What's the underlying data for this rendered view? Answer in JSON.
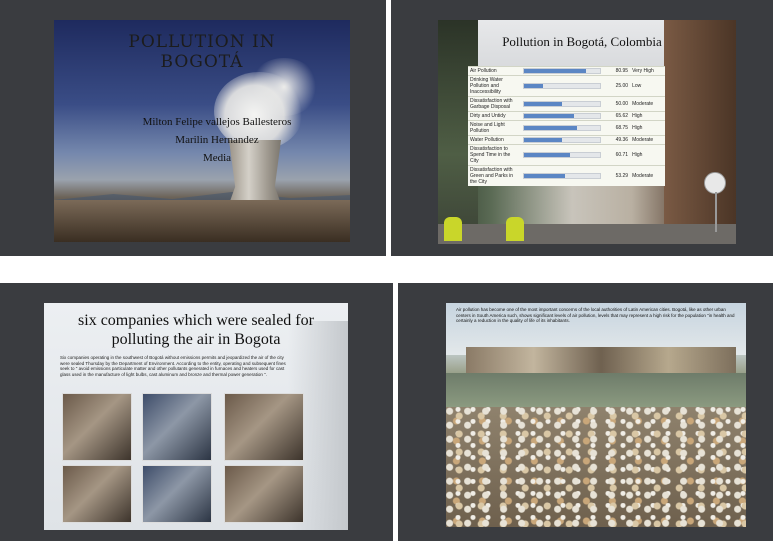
{
  "panels": {
    "top_left": {
      "toolbar": [
        "",
        ""
      ]
    },
    "top_right": {
      "toolbar": [
        "",
        "",
        ""
      ]
    },
    "bottom_left": {
      "toolbar_left": "",
      "toolbar": [
        "",
        "",
        ""
      ]
    },
    "bottom_right": {
      "toolbar_left": "",
      "toolbar": [
        "",
        "",
        "",
        ""
      ]
    }
  },
  "slide1": {
    "title_line1": "POLLUTION IN",
    "title_line2": "BOGOTÁ",
    "authors": [
      "Milton Felipe vallejos Ballesteros",
      "Marilin Hernandez",
      "Media"
    ]
  },
  "slide2": {
    "title": "Pollution in Bogotá, Colombia",
    "rows": [
      {
        "label": "Air Pollution",
        "value": 80.95,
        "value_text": "80.95",
        "level": "Very High"
      },
      {
        "label": "Drinking Water Pollution and Inaccessibility",
        "value": 25.0,
        "value_text": "25.00",
        "level": "Low"
      },
      {
        "label": "Dissatisfaction with Garbage Disposal",
        "value": 50.0,
        "value_text": "50.00",
        "level": "Moderate"
      },
      {
        "label": "Dirty and Untidy",
        "value": 65.62,
        "value_text": "65.62",
        "level": "High"
      },
      {
        "label": "Noise and Light Pollution",
        "value": 68.75,
        "value_text": "68.75",
        "level": "High"
      },
      {
        "label": "Water Pollution",
        "value": 49.36,
        "value_text": "49.36",
        "level": "Moderate"
      },
      {
        "label": "Dissatisfaction to Spend Time in the City",
        "value": 60.71,
        "value_text": "60.71",
        "level": "High"
      },
      {
        "label": "Dissatisfaction with Green and Parks in the City",
        "value": 53.29,
        "value_text": "53.29",
        "level": "Moderate"
      }
    ],
    "colors": {
      "bar_fill": "#5b86c4",
      "table_bg": "#f7f8f1"
    }
  },
  "slide3": {
    "title_line1": "six companies which were sealed for",
    "title_line2": "polluting the air in Bogota",
    "paragraph": "Six companies operating in the southwest of Bogotá without emissions permits and jeopardized the air of the city were sealed Thursday by the Department of Environment. According to the entity, operating and subsequent fines seek to \" avoid emissions particulate matter and other pollutants generated in furnaces and heaters used for cast glass used in the manufacture of light bulbs, cast aluminum and bronze and thermal power generation \"."
  },
  "slide4": {
    "paragraph": "Air pollution has become one of the most important concerns of the local authorities of Latin American cities. Bogotá, like as other urban centers in South America such, shows significant levels of air pollution, levels that may represent a high risk for the population \"in health and certainly a reduction in the quality of life of its inhabitants."
  }
}
